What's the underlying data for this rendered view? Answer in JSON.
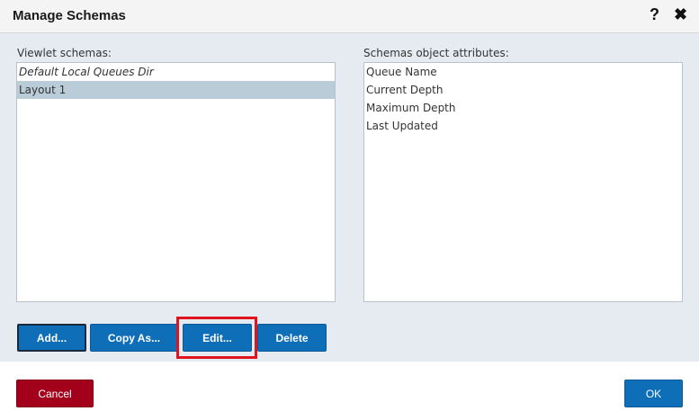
{
  "dialog": {
    "title": "Manage Schemas",
    "help_icon": "?",
    "close_icon": "✖"
  },
  "viewlet_schemas": {
    "label": "Viewlet schemas:",
    "items": [
      {
        "label": "Default Local Queues Dir",
        "italic": true,
        "selected": false
      },
      {
        "label": "Layout 1",
        "italic": false,
        "selected": true
      }
    ]
  },
  "object_attributes": {
    "label": "Schemas object attributes:",
    "items": [
      "Queue Name",
      "Current Depth",
      "Maximum Depth",
      "Last Updated"
    ]
  },
  "actions": {
    "add_label": "Add...",
    "copy_as_label": "Copy As...",
    "edit_label": "Edit...",
    "delete_label": "Delete"
  },
  "footer": {
    "cancel_label": "Cancel",
    "ok_label": "OK"
  },
  "colors": {
    "primary": "#0e6eb8",
    "danger": "#a3001b",
    "highlight": "#e0141e",
    "selected_row": "#b9ccd8",
    "panel_bg": "#e6ebf2"
  }
}
